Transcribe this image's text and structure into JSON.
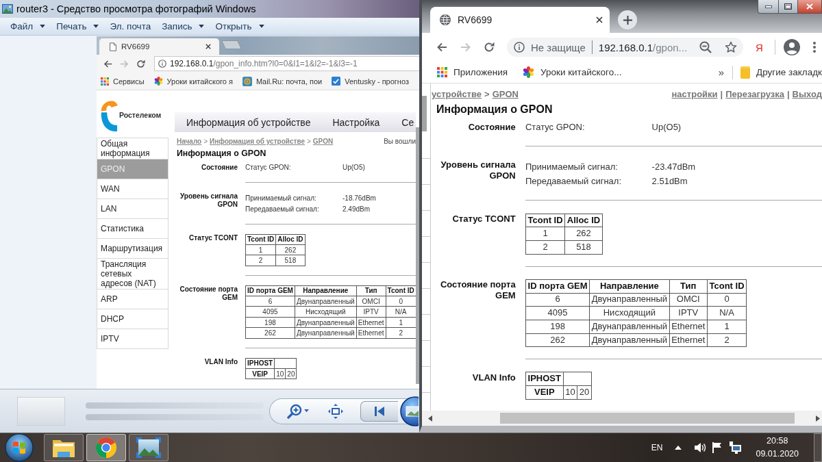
{
  "photo_viewer": {
    "title": "router3 - Средство просмотра фотографий Windows",
    "menu": [
      {
        "label": "Файл",
        "dropdown": true
      },
      {
        "label": "Печать",
        "dropdown": true
      },
      {
        "label": "Эл. почта",
        "dropdown": false
      },
      {
        "label": "Запись",
        "dropdown": true
      },
      {
        "label": "Открыть",
        "dropdown": true
      }
    ],
    "photo": {
      "tab": {
        "title": "RV6699"
      },
      "address": {
        "host": "192.168.0.1",
        "path": "/gpon_info.htm?l0=0&l1=1&l2=-1&l3=-1"
      },
      "bookmarks": [
        {
          "label": "Сервисы"
        },
        {
          "label": "Уроки китайского я"
        },
        {
          "label": "Mail.Ru: почта, пои"
        },
        {
          "label": "Ventusky - прогноз"
        }
      ],
      "page": {
        "logo": "Ростелеком",
        "nav": [
          "Информация об устройстве",
          "Настройка",
          "Се"
        ],
        "sidebar": [
          {
            "label": "Общая информация",
            "selected": false
          },
          {
            "label": "GPON",
            "selected": true
          },
          {
            "label": "WAN",
            "selected": false
          },
          {
            "label": "LAN",
            "selected": false
          },
          {
            "label": "Статистика",
            "selected": false
          },
          {
            "label": "Маршрутизация",
            "selected": false
          },
          {
            "label": "Трансляция сетевых адресов (NAT)",
            "selected": false
          },
          {
            "label": "ARP",
            "selected": false
          },
          {
            "label": "DHCP",
            "selected": false
          },
          {
            "label": "IPTV",
            "selected": false
          }
        ],
        "breadcrumb": {
          "links": [
            "Начало",
            "Информация об устройстве",
            "GPON"
          ],
          "separator": ">"
        },
        "login_note": "Вы вошли",
        "info": {
          "heading": "Информация о GPON",
          "sections": [
            {
              "kind": "fields",
              "label": "Состояние",
              "fields": [
                {
                  "name": "Статус GPON:",
                  "value": "Up(O5)"
                }
              ]
            },
            {
              "kind": "fields",
              "label": "Уровень сигнала GPON",
              "fields": [
                {
                  "name": "Принимаемый сигнал:",
                  "value": "-18.76dBm"
                },
                {
                  "name": "Передаваемый сигнал:",
                  "value": "2.49dBm"
                }
              ]
            },
            {
              "kind": "table",
              "label": "Статус TCONT",
              "columns": [
                "Tcont ID",
                "Alloc ID"
              ],
              "rows": [
                [
                  "1",
                  "262"
                ],
                [
                  "2",
                  "518"
                ]
              ]
            },
            {
              "kind": "table",
              "label": "Состояние порта GEM",
              "columns": [
                "ID порта GEM",
                "Направление",
                "Тип",
                "Tcont ID"
              ],
              "rows": [
                [
                  "6",
                  "Двунаправленный",
                  "OMCI",
                  "0"
                ],
                [
                  "4095",
                  "Нисходящий",
                  "IPTV",
                  "N/A"
                ],
                [
                  "198",
                  "Двунаправленный",
                  "Ethernet",
                  "1"
                ],
                [
                  "262",
                  "Двунаправленный",
                  "Ethernet",
                  "2"
                ]
              ]
            },
            {
              "kind": "matrix",
              "label": "VLAN Info",
              "rows": [
                [
                  "IPHOST"
                ],
                [
                  "VEIP",
                  "10",
                  "20"
                ]
              ]
            }
          ]
        }
      }
    }
  },
  "browser": {
    "tab": {
      "title": "RV6699"
    },
    "omnibox": {
      "security": "Не защище",
      "host": "192.168.0.1",
      "path": "/gpon..."
    },
    "extension": "Я",
    "bookmarks": [
      {
        "label": "Приложения"
      },
      {
        "label": "Уроки китайского..."
      }
    ],
    "overflow": "»",
    "other_bookmarks": "Другие закладк",
    "page": {
      "breadcrumb": {
        "links": [
          "устройстве",
          "GPON"
        ],
        "separator": ">"
      },
      "top_links": {
        "links": [
          "настройки",
          "Перезагрузка",
          "Выход"
        ],
        "separator": "|"
      },
      "info": {
        "heading": "Информация о GPON",
        "sections": [
          {
            "kind": "fields",
            "label": "Состояние",
            "fields": [
              {
                "name": "Статус GPON:",
                "value": "Up(O5)"
              }
            ]
          },
          {
            "kind": "fields",
            "label": "Уровень сигнала GPON",
            "fields": [
              {
                "name": "Принимаемый сигнал:",
                "value": "-23.47dBm"
              },
              {
                "name": "Передаваемый сигнал:",
                "value": "2.51dBm"
              }
            ]
          },
          {
            "kind": "table",
            "label": "Статус TCONT",
            "columns": [
              "Tcont ID",
              "Alloc ID"
            ],
            "rows": [
              [
                "1",
                "262"
              ],
              [
                "2",
                "518"
              ]
            ]
          },
          {
            "kind": "table",
            "label": "Состояние порта GEM",
            "columns": [
              "ID порта GEM",
              "Направление",
              "Тип",
              "Tcont ID"
            ],
            "rows": [
              [
                "6",
                "Двунаправленный",
                "OMCI",
                "0"
              ],
              [
                "4095",
                "Нисходящий",
                "IPTV",
                "N/A"
              ],
              [
                "198",
                "Двунаправленный",
                "Ethernet",
                "1"
              ],
              [
                "262",
                "Двунаправленный",
                "Ethernet",
                "2"
              ]
            ]
          },
          {
            "kind": "matrix",
            "label": "VLAN Info",
            "rows": [
              [
                "IPHOST"
              ],
              [
                "VEIP",
                "10",
                "20"
              ]
            ]
          }
        ]
      }
    }
  },
  "taskbar": {
    "apps": [
      {
        "selected": false
      },
      {
        "selected": true
      },
      {
        "selected": false
      }
    ],
    "language": "EN",
    "time": "20:58",
    "date": "09.01.2020"
  }
}
